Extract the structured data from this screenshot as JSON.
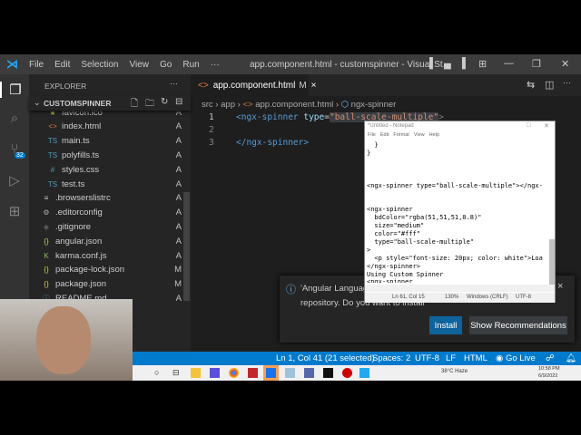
{
  "menu": [
    "File",
    "Edit",
    "Selection",
    "View",
    "Go",
    "Run",
    "···"
  ],
  "window_title": "app.component.html - customspinner - Visual St...",
  "explorer": {
    "title": "EXPLORER",
    "more": "···",
    "folder": "CUSTOMSPINNER",
    "files": [
      {
        "name": "favicon.ico",
        "status": "A",
        "icon": "★",
        "color": "#cbcb41",
        "indent": 1
      },
      {
        "name": "index.html",
        "status": "A",
        "icon": "<>",
        "color": "#e37933",
        "indent": 1
      },
      {
        "name": "main.ts",
        "status": "A",
        "icon": "TS",
        "color": "#519aba",
        "indent": 1
      },
      {
        "name": "polyfills.ts",
        "status": "A",
        "icon": "TS",
        "color": "#519aba",
        "indent": 1
      },
      {
        "name": "styles.css",
        "status": "A",
        "icon": "#",
        "color": "#519aba",
        "indent": 1
      },
      {
        "name": "test.ts",
        "status": "A",
        "icon": "TS",
        "color": "#519aba",
        "indent": 1
      },
      {
        "name": ".browserslistrc",
        "status": "A",
        "icon": "≡",
        "color": "#ccc",
        "indent": 0
      },
      {
        "name": ".editorconfig",
        "status": "A",
        "icon": "⚙",
        "color": "#aaa",
        "indent": 0
      },
      {
        "name": ".gitignore",
        "status": "A",
        "icon": "◆",
        "color": "#555",
        "indent": 0
      },
      {
        "name": "angular.json",
        "status": "A",
        "icon": "{}",
        "color": "#cbcb41",
        "indent": 0
      },
      {
        "name": "karma.conf.js",
        "status": "A",
        "icon": "K",
        "color": "#8dc149",
        "indent": 0
      },
      {
        "name": "package-lock.json",
        "status": "M",
        "icon": "{}",
        "color": "#cbcb41",
        "indent": 0
      },
      {
        "name": "package.json",
        "status": "M",
        "icon": "{}",
        "color": "#cbcb41",
        "indent": 0
      },
      {
        "name": "README.md",
        "status": "A",
        "icon": "ⓘ",
        "color": "#519aba",
        "indent": 0
      }
    ]
  },
  "scm_badge": "32",
  "tab": {
    "label": "app.component.html",
    "modified": "M",
    "close": "×"
  },
  "breadcrumb": [
    "src",
    "app",
    "app.component.html",
    "ngx-spinner"
  ],
  "code": {
    "line_numbers": [
      "1",
      "2",
      "3"
    ],
    "l1_tag": "<ngx-spinner ",
    "l1_attr": "type",
    "l1_eq": "=",
    "l1_val": "\"ball-scale-multiple\"",
    "l1_end": ">",
    "l3": "</ngx-spinner>"
  },
  "notepad": {
    "title": "*Untitled - Notepad",
    "menu": [
      "File",
      "Edit",
      "Format",
      "View",
      "Help"
    ],
    "text": "  }\n}\n\n\n\n<ngx-spinner type=\"ball-scale-multiple\"></ngx-\n\n\n<ngx-spinner\n  bdColor=\"rgba(51,51,51,0.8)\"\n  size=\"medium\"\n  color=\"#fff\"\n  type=\"ball-scale-multiple\"\n>\n  <p style=\"font-size: 20px; color: white\">Loa\n</ngx-spinner>\nUsing Custom Spinner\n<ngx-spinner",
    "status": [
      "Ln 61, Col 15",
      "130%",
      "Windows (CRLF)",
      "UTF-8"
    ]
  },
  "toast": {
    "message_start": "'Angular Languag",
    "message_end": "repository. Do you want to install",
    "install": "Install",
    "show": "Show Recommendations",
    "close": "×"
  },
  "status": {
    "cursor": "Ln 1, Col 41 (21 selected)",
    "spaces": "Spaces: 2",
    "encoding": "UTF-8",
    "eol": "LF",
    "lang": "HTML",
    "golive": "Go Live"
  },
  "taskbar": {
    "weather": "38°C  Haze",
    "time": "10:58 PM",
    "date": "6/9/2022"
  }
}
